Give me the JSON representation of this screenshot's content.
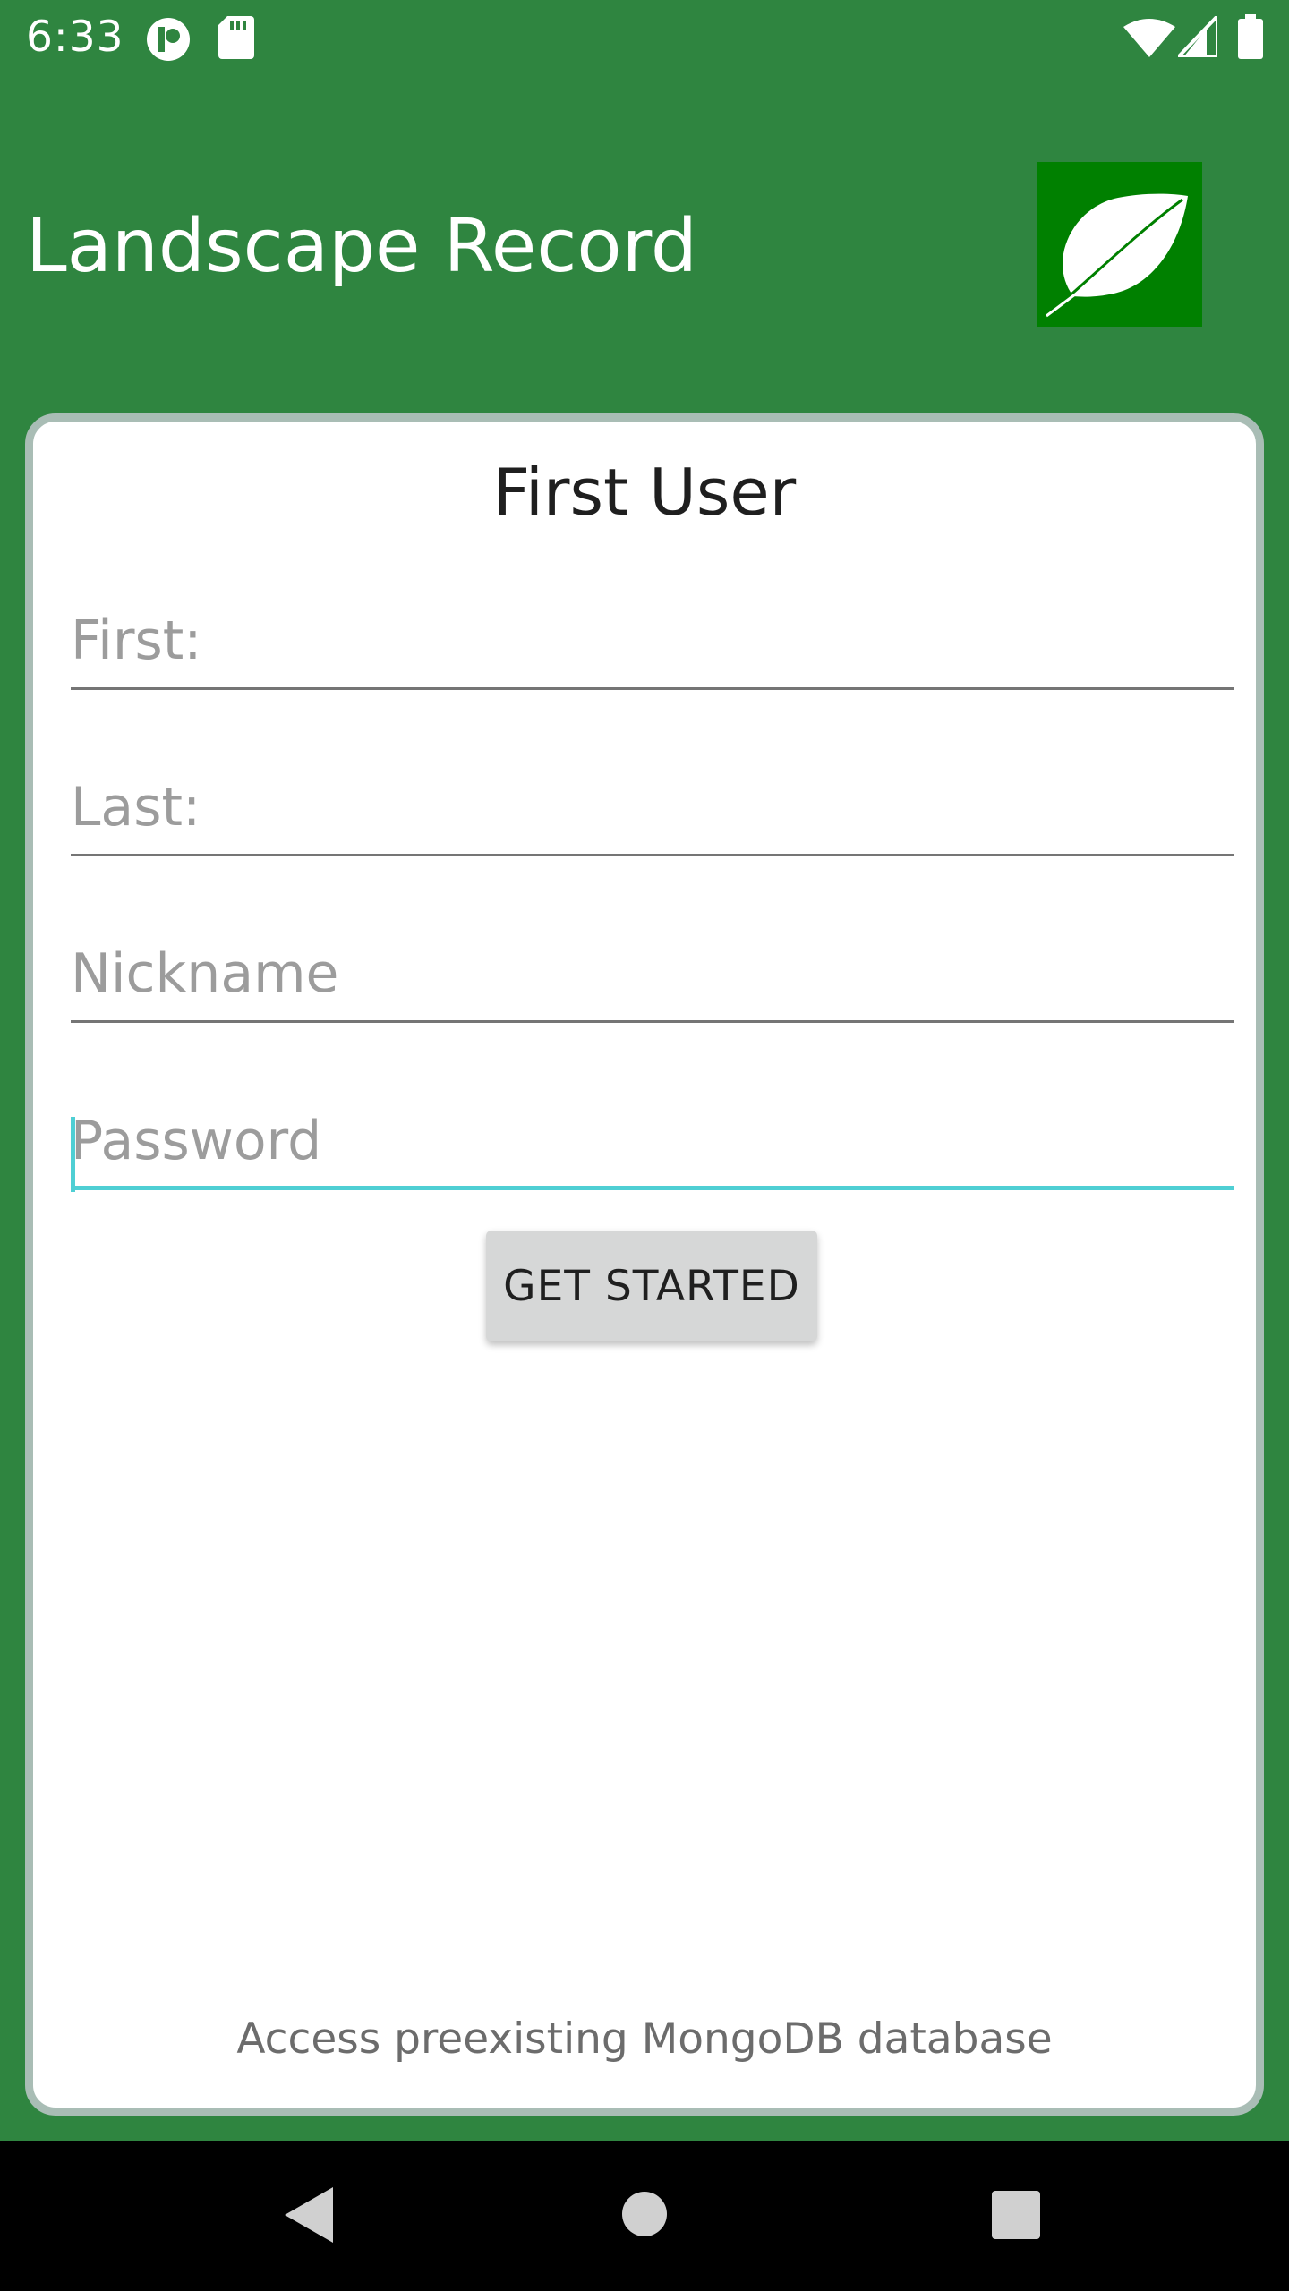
{
  "status_bar": {
    "time": "6:33",
    "icons": [
      "notification-icon",
      "sd-card-icon",
      "wifi-icon",
      "signal-icon",
      "battery-icon"
    ]
  },
  "app_bar": {
    "title": "Landscape Record",
    "logo_icon": "leaf-icon",
    "logo_color": "#008000"
  },
  "form": {
    "title": "First User",
    "fields": {
      "first": {
        "placeholder": "First:",
        "value": ""
      },
      "last": {
        "placeholder": "Last:",
        "value": ""
      },
      "nickname": {
        "placeholder": "Nickname",
        "value": ""
      },
      "password": {
        "placeholder": "Password",
        "value": ""
      }
    },
    "submit_label": "GET STARTED",
    "footer_link": "Access preexisting MongoDB database"
  },
  "nav_bar": {
    "buttons": [
      "back-icon",
      "home-icon",
      "recents-icon"
    ]
  },
  "colors": {
    "background": "#2f8540",
    "accent": "#4fcfd4",
    "card_border": "#a9bdb5",
    "button": "#d6d7d7"
  }
}
